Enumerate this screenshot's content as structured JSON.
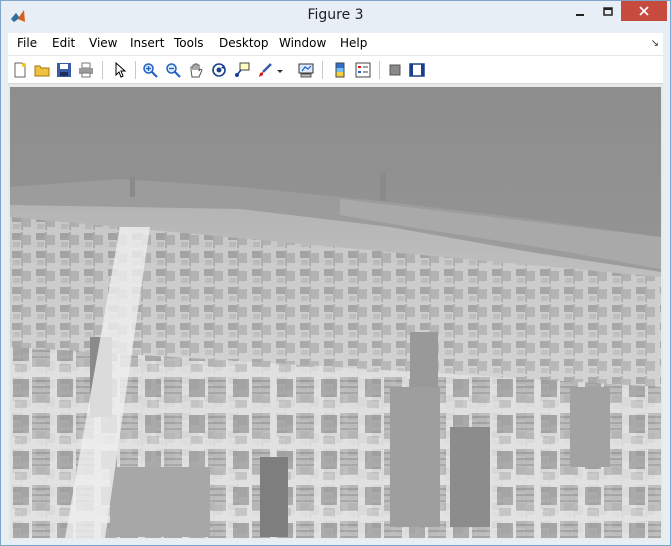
{
  "window": {
    "title": "Figure 3"
  },
  "menu": [
    "File",
    "Edit",
    "View",
    "Insert",
    "Tools",
    "Desktop",
    "Window",
    "Help"
  ],
  "toolbar": [
    "new-figure",
    "open-file",
    "save-figure",
    "print-figure",
    "edit-plot",
    "zoom-in",
    "zoom-out",
    "pan",
    "rotate-3d",
    "data-cursor",
    "brush",
    "brush-options",
    "link-plot",
    "insert-colorbar",
    "insert-legend",
    "hide-plot-tools",
    "show-plot-tools"
  ],
  "figure": {
    "content": "inverted grayscale aerial city image"
  },
  "colors": {
    "titlebar": "#e7eef6",
    "close": "#c74a3f",
    "image_bg": "#e9e9e9"
  }
}
